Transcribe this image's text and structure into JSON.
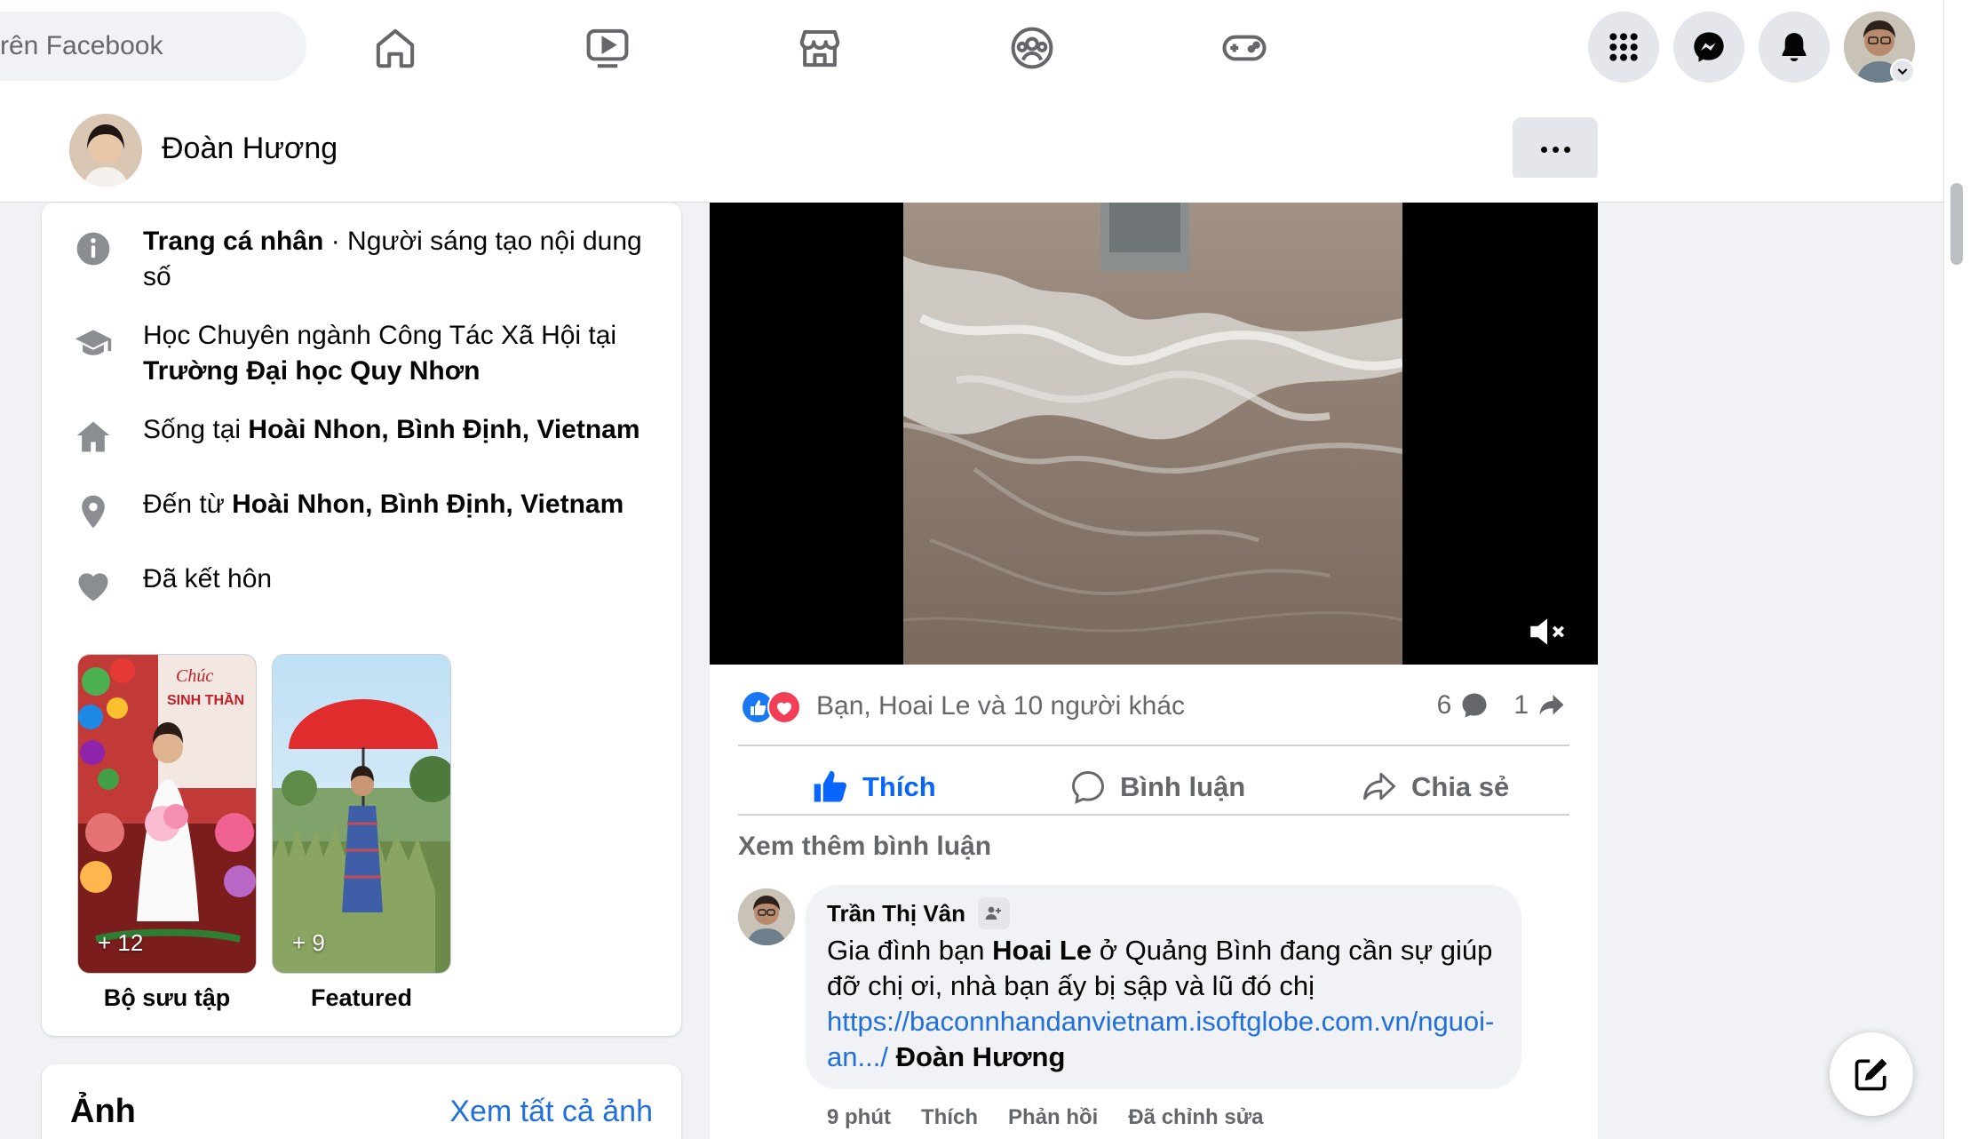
{
  "topbar": {
    "search_placeholder": "rên Facebook",
    "nav_tabs": [
      "home-icon",
      "watch-icon",
      "marketplace-icon",
      "groups-icon",
      "gaming-icon"
    ],
    "right_buttons": [
      "menu-grid-icon",
      "messenger-icon",
      "notifications-icon"
    ]
  },
  "profile": {
    "name": "Đoàn Hương",
    "more_label": "..."
  },
  "intro": {
    "items": [
      {
        "icon": "info-icon",
        "pre": "",
        "bold": "Trang cá nhân",
        "post": " · Người sáng tạo nội dung số"
      },
      {
        "icon": "education-icon",
        "pre": "Học Chuyên ngành Công Tác Xã Hội tại ",
        "bold": "Trường Đại học Quy Nhơn",
        "post": ""
      },
      {
        "icon": "home-icon",
        "pre": "Sống tại ",
        "bold": "Hoài Nhon, Bình Định, Vietnam",
        "post": ""
      },
      {
        "icon": "location-pin-icon",
        "pre": "Đến từ ",
        "bold": "Hoài Nhon, Bình Định, Vietnam",
        "post": ""
      },
      {
        "icon": "heart-icon",
        "pre": "Đã kết hôn",
        "bold": "",
        "post": ""
      }
    ],
    "featured": [
      {
        "count": "+ 12",
        "label": "Bộ sưu tập"
      },
      {
        "count": "+ 9",
        "label": "Featured"
      }
    ]
  },
  "photos": {
    "title": "Ảnh",
    "see_all": "Xem tất cả ảnh"
  },
  "post": {
    "reactions_text": "Bạn, Hoai Le và 10 người khác",
    "comment_count": "6",
    "share_count": "1",
    "actions": {
      "like": "Thích",
      "comment": "Bình luận",
      "share": "Chia sẻ"
    },
    "view_more_comments": "Xem thêm bình luận",
    "comment": {
      "author": "Trần Thị Vân",
      "text_pre": "Gia đình bạn ",
      "text_bold": "Hoai Le",
      "text_post": " ở Quảng Bình đang cần sự giúp đỡ chị ơi, nhà bạn ấy bị sập và lũ đó chị ",
      "link": "https://baconnhandanvietnam.isoftglobe.com.vn/nguoi-an.../",
      "mention": "Đoàn Hương",
      "time": "9 phút",
      "like": "Thích",
      "reply": "Phản hồi",
      "edited": "Đã chỉnh sửa"
    }
  },
  "colors": {
    "accent": "#0866ff",
    "link": "#216fdb",
    "secondary_text": "#65676b",
    "icon_gray": "#65676b"
  }
}
